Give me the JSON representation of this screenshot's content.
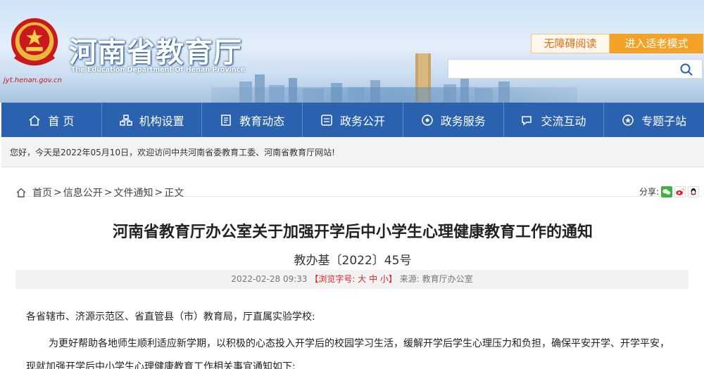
{
  "header": {
    "site_name": "河南省教育厅",
    "site_name_en": "The Education Department Of Henan Province",
    "site_url": "jyt.henan.gov.cn",
    "accessibility_label": "无障碍阅读",
    "elder_mode_label": "进入适老模式",
    "search_placeholder": ""
  },
  "nav": {
    "items": [
      {
        "label": "首 页",
        "icon": "home-icon"
      },
      {
        "label": "机构设置",
        "icon": "org-icon"
      },
      {
        "label": "教育动态",
        "icon": "news-icon"
      },
      {
        "label": "政务公开",
        "icon": "doc-icon"
      },
      {
        "label": "政务服务",
        "icon": "service-icon"
      },
      {
        "label": "交流互动",
        "icon": "chat-icon"
      },
      {
        "label": "专题子站",
        "icon": "topic-icon"
      }
    ]
  },
  "greeting": "您好，今天是2022年05月10日，欢迎访问中共河南省委教育工委、河南省教育厅网站!",
  "breadcrumb": {
    "home": "首页",
    "sep1": ">",
    "info": "信息公开",
    "sep2": ">",
    "notice": "文件通知",
    "sep3": ">",
    "current": "正文"
  },
  "share": {
    "label": "分享:"
  },
  "article": {
    "title": "河南省教育厅办公室关于加强开学后中小学生心理健康教育工作的通知",
    "doc_number": "教办基〔2022〕45号",
    "date": "2022-02-28 09:33",
    "font_size_label": "【浏览字号: 大 中 小】",
    "source": "来源: 教育厅办公室",
    "salutation": "各省辖市、济源示范区、省直管县（市）教育局，厅直属实验学校:",
    "paragraph1": "为更好帮助各地师生顺利适应新学期，以积极的心态投入开学后的校园学习生活，缓解开学后学生心理压力和负担，确保平安开学、开学平安，现就加强开学后中小学生心理健康教育工作相关事宜通知如下:"
  },
  "colors": {
    "nav_bg": "#2a62b0",
    "accent_orange": "#f3a227",
    "emblem_red": "#c9181e"
  }
}
